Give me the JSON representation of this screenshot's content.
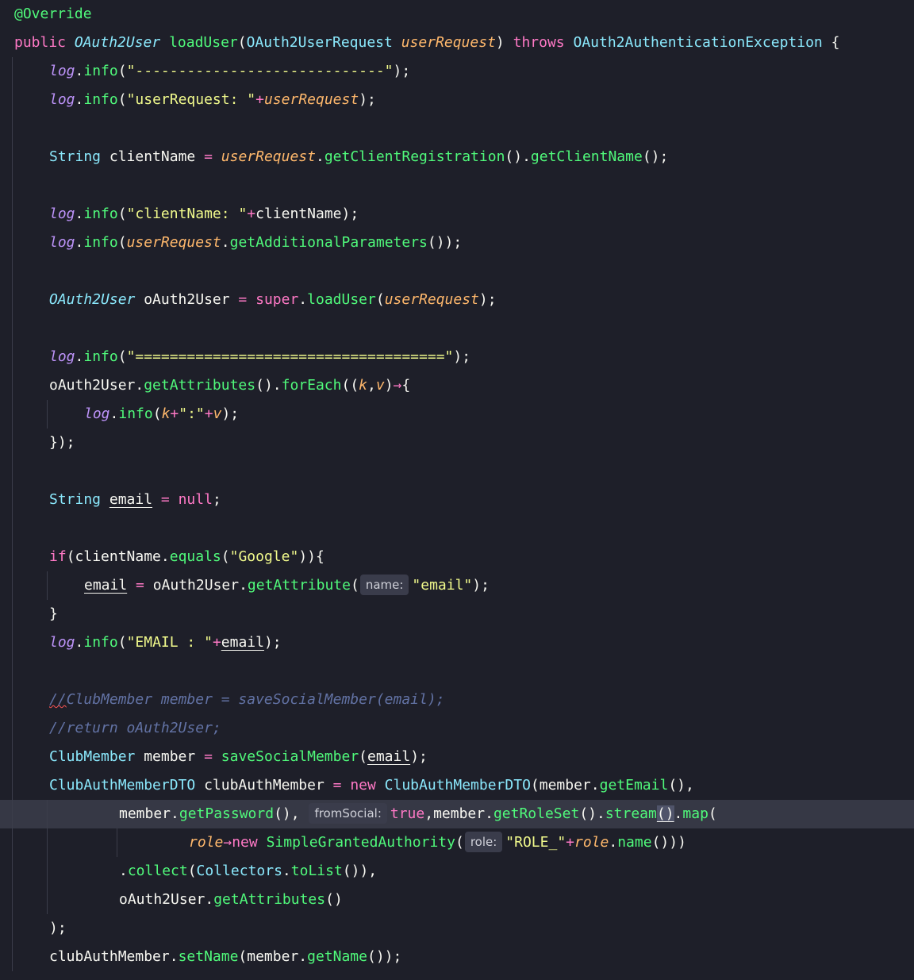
{
  "editor": {
    "lines": [
      {
        "indent": 0,
        "guides": [],
        "tokens": [
          {
            "t": "@Override",
            "c": "ann"
          }
        ]
      },
      {
        "indent": 0,
        "guides": [],
        "tokens": [
          {
            "t": "public ",
            "c": "kw"
          },
          {
            "t": "OAuth2User",
            "c": "typei"
          },
          {
            "t": " "
          },
          {
            "t": "loadUser",
            "c": "fn"
          },
          {
            "t": "("
          },
          {
            "t": "OAuth2UserRequest",
            "c": "type"
          },
          {
            "t": " "
          },
          {
            "t": "userRequest",
            "c": "param"
          },
          {
            "t": ") "
          },
          {
            "t": "throws",
            "c": "kw"
          },
          {
            "t": " "
          },
          {
            "t": "OAuth2AuthenticationException",
            "c": "type"
          },
          {
            "t": " {"
          }
        ]
      },
      {
        "indent": 1,
        "guides": [
          1
        ],
        "tokens": [
          {
            "t": "log",
            "c": "field"
          },
          {
            "t": "."
          },
          {
            "t": "info",
            "c": "fn"
          },
          {
            "t": "("
          },
          {
            "t": "\"-----------------------------\"",
            "c": "str"
          },
          {
            "t": ");"
          }
        ]
      },
      {
        "indent": 1,
        "guides": [
          1
        ],
        "tokens": [
          {
            "t": "log",
            "c": "field"
          },
          {
            "t": "."
          },
          {
            "t": "info",
            "c": "fn"
          },
          {
            "t": "("
          },
          {
            "t": "\"userRequest: \"",
            "c": "str"
          },
          {
            "t": "+",
            "c": "op"
          },
          {
            "t": "userRequest",
            "c": "param"
          },
          {
            "t": ");"
          }
        ]
      },
      {
        "indent": 1,
        "guides": [
          1
        ],
        "tokens": []
      },
      {
        "indent": 1,
        "guides": [
          1
        ],
        "tokens": [
          {
            "t": "String",
            "c": "type"
          },
          {
            "t": " clientName "
          },
          {
            "t": "=",
            "c": "op"
          },
          {
            "t": " "
          },
          {
            "t": "userRequest",
            "c": "param"
          },
          {
            "t": "."
          },
          {
            "t": "getClientRegistration",
            "c": "fn"
          },
          {
            "t": "()."
          },
          {
            "t": "getClientName",
            "c": "fn"
          },
          {
            "t": "();"
          }
        ]
      },
      {
        "indent": 1,
        "guides": [
          1
        ],
        "tokens": []
      },
      {
        "indent": 1,
        "guides": [
          1
        ],
        "tokens": [
          {
            "t": "log",
            "c": "field"
          },
          {
            "t": "."
          },
          {
            "t": "info",
            "c": "fn"
          },
          {
            "t": "("
          },
          {
            "t": "\"clientName: \"",
            "c": "str"
          },
          {
            "t": "+",
            "c": "op"
          },
          {
            "t": "clientName);"
          }
        ]
      },
      {
        "indent": 1,
        "guides": [
          1
        ],
        "tokens": [
          {
            "t": "log",
            "c": "field"
          },
          {
            "t": "."
          },
          {
            "t": "info",
            "c": "fn"
          },
          {
            "t": "("
          },
          {
            "t": "userRequest",
            "c": "param"
          },
          {
            "t": "."
          },
          {
            "t": "getAdditionalParameters",
            "c": "fn"
          },
          {
            "t": "());"
          }
        ]
      },
      {
        "indent": 1,
        "guides": [
          1
        ],
        "tokens": []
      },
      {
        "indent": 1,
        "guides": [
          1
        ],
        "tokens": [
          {
            "t": "OAuth2User",
            "c": "typei"
          },
          {
            "t": " oAuth2User "
          },
          {
            "t": "=",
            "c": "op"
          },
          {
            "t": " "
          },
          {
            "t": "super",
            "c": "kw"
          },
          {
            "t": "."
          },
          {
            "t": "loadUser",
            "c": "fn"
          },
          {
            "t": "("
          },
          {
            "t": "userRequest",
            "c": "param"
          },
          {
            "t": ");"
          }
        ]
      },
      {
        "indent": 1,
        "guides": [
          1
        ],
        "tokens": []
      },
      {
        "indent": 1,
        "guides": [
          1
        ],
        "tokens": [
          {
            "t": "log",
            "c": "field"
          },
          {
            "t": "."
          },
          {
            "t": "info",
            "c": "fn"
          },
          {
            "t": "("
          },
          {
            "t": "\"====================================\"",
            "c": "str"
          },
          {
            "t": ");"
          }
        ]
      },
      {
        "indent": 1,
        "guides": [
          1
        ],
        "tokens": [
          {
            "t": "oAuth2User."
          },
          {
            "t": "getAttributes",
            "c": "fn"
          },
          {
            "t": "()."
          },
          {
            "t": "forEach",
            "c": "fn"
          },
          {
            "t": "(("
          },
          {
            "t": "k",
            "c": "param"
          },
          {
            "t": ","
          },
          {
            "t": "v",
            "c": "param"
          },
          {
            "t": ")"
          },
          {
            "t": "→",
            "c": "op"
          },
          {
            "t": "{"
          }
        ]
      },
      {
        "indent": 2,
        "guides": [
          1,
          2
        ],
        "tokens": [
          {
            "t": "log",
            "c": "field"
          },
          {
            "t": "."
          },
          {
            "t": "info",
            "c": "fn"
          },
          {
            "t": "("
          },
          {
            "t": "k",
            "c": "param"
          },
          {
            "t": "+",
            "c": "op"
          },
          {
            "t": "\":\"",
            "c": "str"
          },
          {
            "t": "+",
            "c": "op"
          },
          {
            "t": "v",
            "c": "param"
          },
          {
            "t": ");"
          }
        ]
      },
      {
        "indent": 1,
        "guides": [
          1
        ],
        "tokens": [
          {
            "t": "});"
          }
        ]
      },
      {
        "indent": 1,
        "guides": [
          1
        ],
        "tokens": []
      },
      {
        "indent": 1,
        "guides": [
          1
        ],
        "tokens": [
          {
            "t": "String",
            "c": "type"
          },
          {
            "t": " "
          },
          {
            "t": "email",
            "c": "und"
          },
          {
            "t": " "
          },
          {
            "t": "=",
            "c": "op"
          },
          {
            "t": " "
          },
          {
            "t": "null",
            "c": "kw"
          },
          {
            "t": ";"
          }
        ]
      },
      {
        "indent": 1,
        "guides": [
          1
        ],
        "tokens": []
      },
      {
        "indent": 1,
        "guides": [
          1
        ],
        "tokens": [
          {
            "t": "if",
            "c": "kw"
          },
          {
            "t": "(clientName."
          },
          {
            "t": "equals",
            "c": "fn"
          },
          {
            "t": "("
          },
          {
            "t": "\"Google\"",
            "c": "str"
          },
          {
            "t": ")){"
          }
        ]
      },
      {
        "indent": 2,
        "guides": [
          1,
          2
        ],
        "tokens": [
          {
            "t": "email",
            "c": "und"
          },
          {
            "t": " "
          },
          {
            "t": "=",
            "c": "op"
          },
          {
            "t": " oAuth2User."
          },
          {
            "t": "getAttribute",
            "c": "fn"
          },
          {
            "t": "("
          },
          {
            "hint": "name:",
            "name": "param-hint-name"
          },
          {
            "t": "\"email\"",
            "c": "str"
          },
          {
            "t": ");"
          }
        ]
      },
      {
        "indent": 1,
        "guides": [
          1
        ],
        "tokens": [
          {
            "t": "}"
          }
        ]
      },
      {
        "indent": 1,
        "guides": [
          1
        ],
        "tokens": [
          {
            "t": "log",
            "c": "field"
          },
          {
            "t": "."
          },
          {
            "t": "info",
            "c": "fn"
          },
          {
            "t": "("
          },
          {
            "t": "\"EMAIL : \"",
            "c": "str"
          },
          {
            "t": "+",
            "c": "op"
          },
          {
            "t": "email",
            "c": "und"
          },
          {
            "t": ");"
          }
        ]
      },
      {
        "indent": 1,
        "guides": [
          1
        ],
        "tokens": []
      },
      {
        "indent": 1,
        "guides": [
          1
        ],
        "tokens": [
          {
            "t": "//",
            "c": "cmt squig"
          },
          {
            "t": "ClubMember member = saveSocialMember(email);",
            "c": "cmt"
          }
        ]
      },
      {
        "indent": 1,
        "guides": [
          1
        ],
        "tokens": [
          {
            "t": "//return oAuth2User;",
            "c": "cmt"
          }
        ]
      },
      {
        "indent": 1,
        "guides": [
          1
        ],
        "tokens": [
          {
            "t": "ClubMember",
            "c": "type"
          },
          {
            "t": " member "
          },
          {
            "t": "=",
            "c": "op"
          },
          {
            "t": " "
          },
          {
            "t": "saveSocialMember",
            "c": "fn"
          },
          {
            "t": "("
          },
          {
            "t": "email",
            "c": "und"
          },
          {
            "t": ");"
          }
        ]
      },
      {
        "indent": 1,
        "guides": [
          1
        ],
        "tokens": [
          {
            "t": "ClubAuthMemberDTO",
            "c": "type"
          },
          {
            "t": " clubAuthMember "
          },
          {
            "t": "=",
            "c": "op"
          },
          {
            "t": " "
          },
          {
            "t": "new",
            "c": "kw"
          },
          {
            "t": " "
          },
          {
            "t": "ClubAuthMemberDTO",
            "c": "type"
          },
          {
            "t": "(member."
          },
          {
            "t": "getEmail",
            "c": "fn"
          },
          {
            "t": "(),"
          }
        ]
      },
      {
        "indent": 3,
        "guides": [
          1,
          2
        ],
        "current": true,
        "tokens": [
          {
            "t": "member."
          },
          {
            "t": "getPassword",
            "c": "fn"
          },
          {
            "t": "(), "
          },
          {
            "hint": "fromSocial:",
            "name": "param-hint-fromsocial"
          },
          {
            "t": "true",
            "c": "kw"
          },
          {
            "t": ",member."
          },
          {
            "t": "getRoleSet",
            "c": "fn"
          },
          {
            "t": "()."
          },
          {
            "t": "stream",
            "c": "fn"
          },
          {
            "t": "()",
            "c": "und caret"
          },
          {
            "t": "."
          },
          {
            "t": "map",
            "c": "fn"
          },
          {
            "t": "("
          }
        ]
      },
      {
        "indent": 5,
        "guides": [
          1,
          2,
          4
        ],
        "tokens": [
          {
            "t": "role",
            "c": "param"
          },
          {
            "t": "→",
            "c": "op"
          },
          {
            "t": "new",
            "c": "kw"
          },
          {
            "t": " "
          },
          {
            "t": "SimpleGrantedAuthority",
            "c": "fn"
          },
          {
            "t": "("
          },
          {
            "hint": "role:",
            "name": "param-hint-role"
          },
          {
            "t": "\"ROLE_\"",
            "c": "str"
          },
          {
            "t": "+",
            "c": "op"
          },
          {
            "t": "role",
            "c": "param"
          },
          {
            "t": "."
          },
          {
            "t": "name",
            "c": "fn"
          },
          {
            "t": "()))"
          }
        ]
      },
      {
        "indent": 3,
        "guides": [
          1,
          2
        ],
        "tokens": [
          {
            "t": "."
          },
          {
            "t": "collect",
            "c": "fn"
          },
          {
            "t": "("
          },
          {
            "t": "Collectors",
            "c": "type"
          },
          {
            "t": "."
          },
          {
            "t": "toList",
            "c": "fn"
          },
          {
            "t": "()),"
          }
        ]
      },
      {
        "indent": 3,
        "guides": [
          1,
          2
        ],
        "tokens": [
          {
            "t": "oAuth2User."
          },
          {
            "t": "getAttributes",
            "c": "fn"
          },
          {
            "t": "()"
          }
        ]
      },
      {
        "indent": 1,
        "guides": [
          1
        ],
        "tokens": [
          {
            "t": ");"
          }
        ]
      },
      {
        "indent": 1,
        "guides": [
          1
        ],
        "tokens": [
          {
            "t": "clubAuthMember."
          },
          {
            "t": "setName",
            "c": "fn"
          },
          {
            "t": "(member."
          },
          {
            "t": "getName",
            "c": "fn"
          },
          {
            "t": "());"
          }
        ]
      }
    ]
  }
}
